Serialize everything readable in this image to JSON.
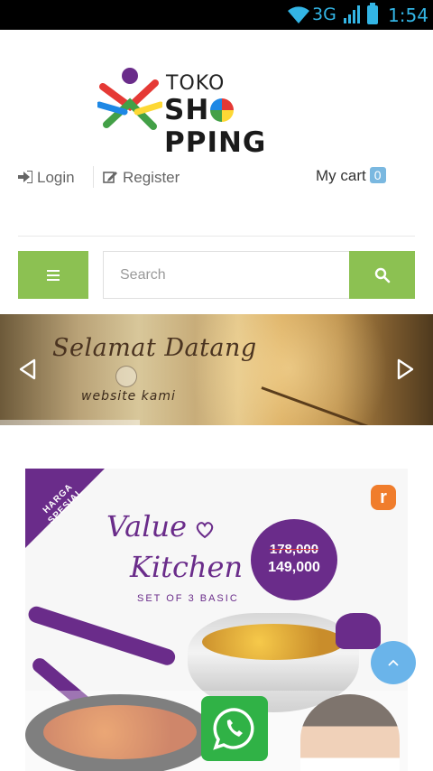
{
  "status_bar": {
    "network": "3G",
    "time": "1:54",
    "icons": [
      "wifi-icon",
      "signal-icon",
      "battery-icon"
    ]
  },
  "logo": {
    "line1": "TOKO",
    "line2_prefix": "SH",
    "line2_suffix": "PPING"
  },
  "account": {
    "login_label": "Login",
    "register_label": "Register",
    "login_icon": "sign-in-icon",
    "register_icon": "edit-icon"
  },
  "cart": {
    "label": "My cart",
    "count": "0"
  },
  "search": {
    "placeholder": "Search",
    "menu_icon": "hamburger-icon",
    "search_icon": "magnifier-icon"
  },
  "slider": {
    "title": "Selamat Datang",
    "subtitle": "website kami",
    "prev_icon": "chevron-left-icon",
    "next_icon": "chevron-right-icon"
  },
  "promo": {
    "ribbon": "HARGA SPESIAL",
    "brand_letter": "r",
    "title_line1": "Value",
    "title_line2": "Kitchen",
    "tagline": "SET OF 3 BASIC",
    "price_old": "178,000",
    "price_new": "149,000"
  },
  "floating": {
    "whatsapp_icon": "whatsapp-icon",
    "scroll_top_icon": "chevron-up-icon"
  },
  "colors": {
    "accent_green": "#8cc152",
    "promo_purple": "#6a2c8a",
    "cart_badge": "#7ab8e0",
    "status_blue": "#33b5e5",
    "whatsapp_green": "#30b246",
    "scroll_button": "#6ab4ea"
  }
}
